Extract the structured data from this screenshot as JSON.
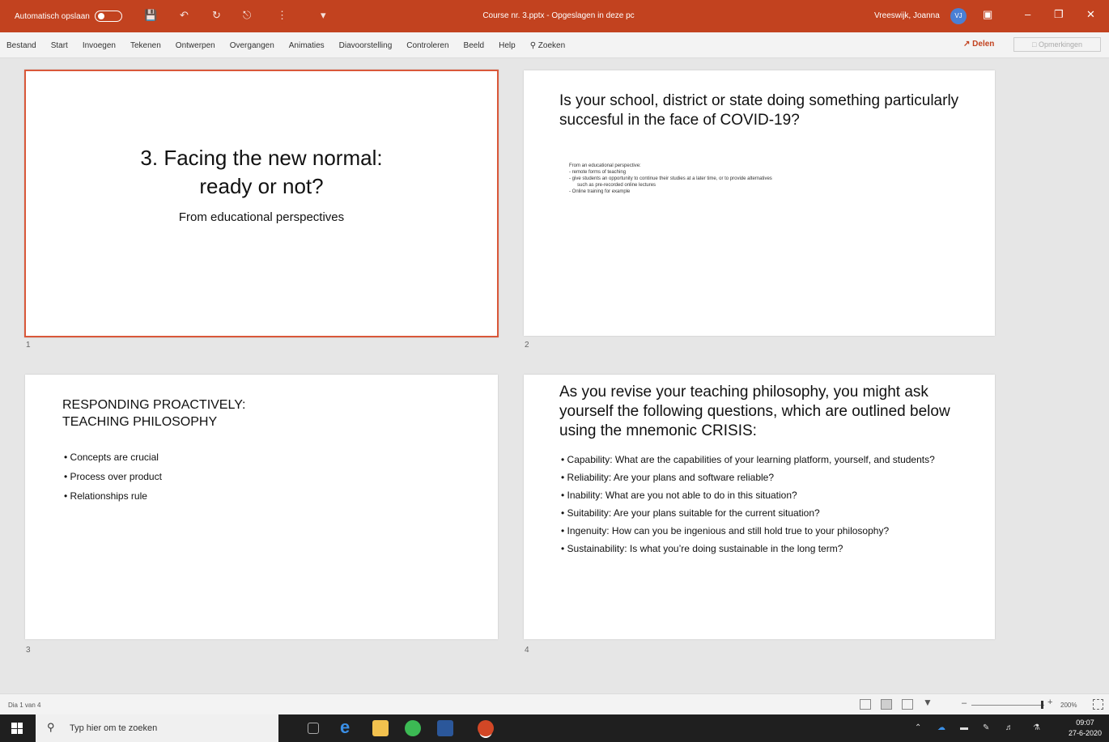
{
  "titlebar": {
    "autosave_label": "Automatisch opslaan",
    "title": "Course nr. 3.pptx  -  Opgeslagen in deze pc",
    "user": "Vreeswijk, Joanna",
    "avatar_initials": "VJ",
    "accent": "#c2421f"
  },
  "ribbon": {
    "tabs": [
      "Bestand",
      "Start",
      "Invoegen",
      "Tekenen",
      "Ontwerpen",
      "Overgangen",
      "Animaties",
      "Diavoorstelling",
      "Controleren",
      "Beeld",
      "Help"
    ],
    "search_label": "Zoeken",
    "share_label": "Delen",
    "comments_label": "Opmerkingen"
  },
  "slides": [
    {
      "number": "1",
      "title_line1": "3. Facing the new normal:",
      "title_line2": "ready or not?",
      "subtitle": "From educational perspectives"
    },
    {
      "number": "2",
      "title": "Is your school, district or state doing something particularly succesful in the face of COVID-19?",
      "body": [
        "From an educational perspective:",
        "-   remote forms of teaching",
        "-   give students an opportunity to continue their studies at a later time, or to provide alternatives",
        "    such as pre-recorded online lectures",
        "-   Online training for example"
      ]
    },
    {
      "number": "3",
      "title_line1": "RESPONDING PROACTIVELY:",
      "title_line2": "TEACHING PHILOSOPHY",
      "bullets": [
        "• Concepts are crucial",
        "• Process over product",
        "• Relationships rule"
      ]
    },
    {
      "number": "4",
      "title": "As you revise your teaching philosophy, you might ask yourself the following questions, which are outlined below using the mnemonic CRISIS:",
      "bullets": [
        "• Capability: What are the capabilities of your learning platform, yourself, and students?",
        "• Reliability: Are your plans and software reliable?",
        "• Inability: What are you not able to do in this situation?",
        "• Suitability: Are your plans suitable for the current situation?",
        "• Ingenuity: How can you be ingenious and still hold true to your philosophy?",
        "• Sustainability: Is what you’re doing sustainable in the long term?"
      ]
    }
  ],
  "statusbar": {
    "slide_position": "Dia 1 van 4",
    "zoom_level": "200%"
  },
  "taskbar": {
    "search_placeholder": "Typ hier om te zoeken",
    "time": "09:07",
    "date": "27-6-2020"
  }
}
